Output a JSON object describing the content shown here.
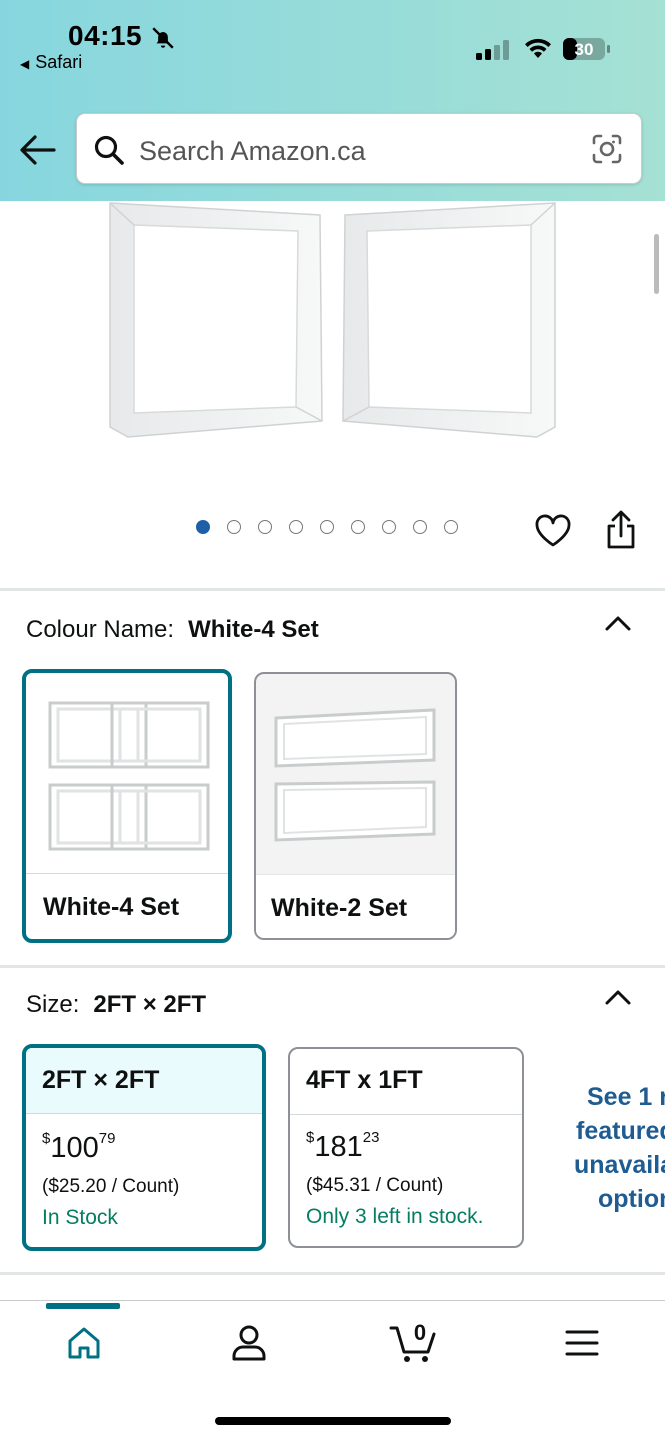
{
  "status_bar": {
    "time": "04:15",
    "back_app": "Safari",
    "battery": "30"
  },
  "search": {
    "placeholder": "Search Amazon.ca"
  },
  "gallery": {
    "image_count": 9,
    "active_index": 0
  },
  "colour": {
    "label": "Colour Name:",
    "selected": "White-4 Set",
    "options": [
      {
        "label": "White-4 Set"
      },
      {
        "label": "White-2 Set"
      }
    ]
  },
  "size": {
    "label": "Size:",
    "selected": "2FT × 2FT",
    "options": [
      {
        "label": "2FT × 2FT",
        "price_whole": "100",
        "price_cents": "79",
        "currency": "$",
        "unit_price": "($25.20 / Count)",
        "stock": "In Stock"
      },
      {
        "label": "4FT x 1FT",
        "price_whole": "181",
        "price_cents": "23",
        "currency": "$",
        "unit_price": "($45.31 / Count)",
        "stock": "Only 3 left in stock."
      }
    ],
    "more_lines": [
      "See 1 r",
      "featured",
      "unavaila",
      "option"
    ]
  },
  "tabbar": {
    "active": "home",
    "cart_count": "0"
  },
  "colors": {
    "teal": "#007185",
    "stock_green": "#067d62",
    "link_blue": "#1f5c91",
    "dot_active": "#1d5fa8"
  }
}
